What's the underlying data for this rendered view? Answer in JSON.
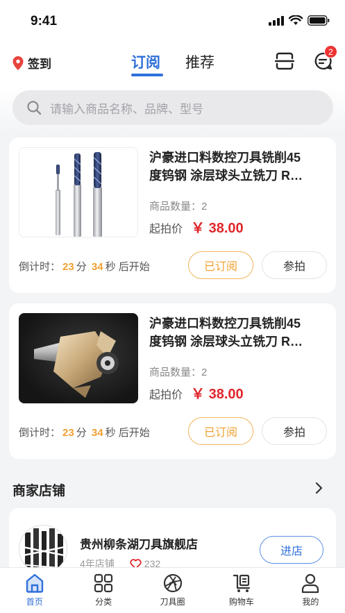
{
  "status_bar": {
    "time": "9:41"
  },
  "nav": {
    "sign_in": "签到",
    "tabs": [
      {
        "label": "订阅",
        "active": true
      },
      {
        "label": "推荐",
        "active": false
      }
    ],
    "message_badge": "2"
  },
  "search": {
    "placeholder": "请输入商品名称、品牌、型号"
  },
  "products": [
    {
      "title_line1": "沪豪进口料数控刀具铣削45",
      "title_line2": "度钨钢 涂层球头立铣刀 R…",
      "quantity_label": "商品数量：",
      "quantity": "2",
      "price_label": "起拍价",
      "price": "￥ 38.00",
      "countdown_prefix": "倒计时：",
      "minutes": "23",
      "minutes_unit": "分",
      "seconds": "34",
      "seconds_unit": "秒",
      "countdown_suffix": "后开始",
      "subscribed_label": "已订阅",
      "bid_label": "参拍"
    },
    {
      "title_line1": "沪豪进口料数控刀具铣削45",
      "title_line2": "度钨钢 涂层球头立铣刀 R…",
      "quantity_label": "商品数量：",
      "quantity": "2",
      "price_label": "起拍价",
      "price": "￥ 38.00",
      "countdown_prefix": "倒计时：",
      "minutes": "23",
      "minutes_unit": "分",
      "seconds": "34",
      "seconds_unit": "秒",
      "countdown_suffix": "后开始",
      "subscribed_label": "已订阅",
      "bid_label": "参拍"
    }
  ],
  "shops_section": {
    "title": "商家店铺",
    "shop": {
      "name": "贵州柳条湖刀具旗舰店",
      "years": "4年店铺",
      "likes": "232",
      "enter_label": "进店"
    }
  },
  "tab_bar": [
    {
      "label": "首页",
      "icon": "home-icon",
      "active": true
    },
    {
      "label": "分类",
      "icon": "grid-icon",
      "active": false
    },
    {
      "label": "刀具圈",
      "icon": "aperture-icon",
      "active": false
    },
    {
      "label": "购物车",
      "icon": "cart-icon",
      "active": false
    },
    {
      "label": "我的",
      "icon": "person-icon",
      "active": false
    }
  ],
  "colors": {
    "accent": "#2f6fd9",
    "price": "#e0262b",
    "countdown": "#f0a030",
    "subscribed": "#f0a030"
  }
}
